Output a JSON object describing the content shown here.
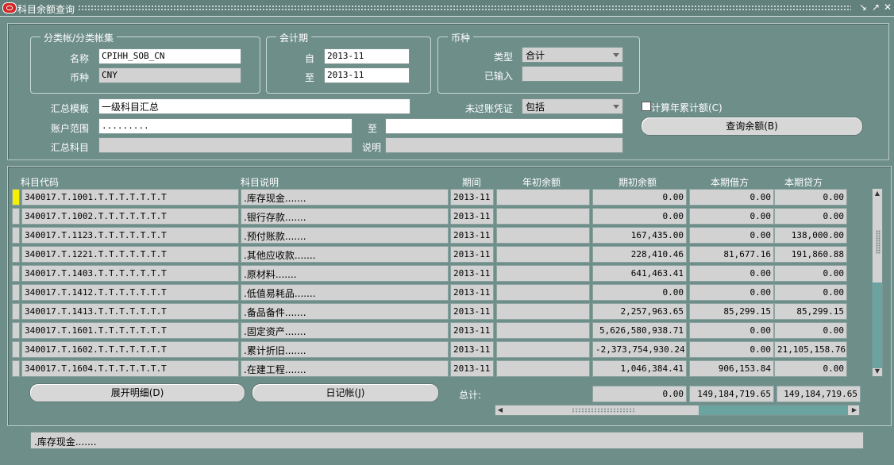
{
  "window": {
    "title": "科目余额查询"
  },
  "ledger_group": {
    "legend": "分类帐/分类帐集",
    "name_label": "名称",
    "name_value": "CPIHH_SOB_CN",
    "currency_label": "币种",
    "currency_value": "CNY"
  },
  "period_group": {
    "legend": "会计期",
    "from_label": "自",
    "from_value": "2013-11",
    "to_label": "至",
    "to_value": "2013-11"
  },
  "currency_group": {
    "legend": "币种",
    "type_label": "类型",
    "type_value": "合计",
    "entered_label": "已输入",
    "entered_value": ""
  },
  "summary": {
    "template_label": "汇总模板",
    "template_value": "一级科目汇总",
    "unposted_label": "未过账凭证",
    "unposted_value": "包括",
    "ytd_label": "计算年累计额(C)",
    "range_label": "账户范围",
    "range_from": ".........",
    "range_to_label": "至",
    "range_to": "",
    "summary_account_label": "汇总科目",
    "summary_account_value": "",
    "desc_label": "说明",
    "desc_value": "",
    "query_button": "查询余额(B)"
  },
  "table": {
    "headers": [
      "科目代码",
      "科目说明",
      "期间",
      "年初余额",
      "期初余额",
      "本期借方",
      "本期贷方"
    ],
    "rows": [
      {
        "code": "340017.T.1001.T.T.T.T.T.T.T",
        "desc": ".库存现金.......",
        "period": "2013-11",
        "year_begin": "",
        "begin": "0.00",
        "debit": "0.00",
        "credit": "0.00"
      },
      {
        "code": "340017.T.1002.T.T.T.T.T.T.T",
        "desc": ".银行存款.......",
        "period": "2013-11",
        "year_begin": "",
        "begin": "0.00",
        "debit": "0.00",
        "credit": "0.00"
      },
      {
        "code": "340017.T.1123.T.T.T.T.T.T.T",
        "desc": ".预付账款.......",
        "period": "2013-11",
        "year_begin": "",
        "begin": "167,435.00",
        "debit": "0.00",
        "credit": "138,000.00"
      },
      {
        "code": "340017.T.1221.T.T.T.T.T.T.T",
        "desc": ".其他应收款.......",
        "period": "2013-11",
        "year_begin": "",
        "begin": "228,410.46",
        "debit": "81,677.16",
        "credit": "191,860.88"
      },
      {
        "code": "340017.T.1403.T.T.T.T.T.T.T",
        "desc": ".原材料.......",
        "period": "2013-11",
        "year_begin": "",
        "begin": "641,463.41",
        "debit": "0.00",
        "credit": "0.00"
      },
      {
        "code": "340017.T.1412.T.T.T.T.T.T.T",
        "desc": ".低值易耗品.......",
        "period": "2013-11",
        "year_begin": "",
        "begin": "0.00",
        "debit": "0.00",
        "credit": "0.00"
      },
      {
        "code": "340017.T.1413.T.T.T.T.T.T.T",
        "desc": ".备品备件.......",
        "period": "2013-11",
        "year_begin": "",
        "begin": "2,257,963.65",
        "debit": "85,299.15",
        "credit": "85,299.15"
      },
      {
        "code": "340017.T.1601.T.T.T.T.T.T.T",
        "desc": ".固定资产.......",
        "period": "2013-11",
        "year_begin": "",
        "begin": "5,626,580,938.71",
        "debit": "0.00",
        "credit": "0.00"
      },
      {
        "code": "340017.T.1602.T.T.T.T.T.T.T",
        "desc": ".累计折旧.......",
        "period": "2013-11",
        "year_begin": "",
        "begin": "-2,373,754,930.24",
        "debit": "0.00",
        "credit": "21,105,158.76"
      },
      {
        "code": "340017.T.1604.T.T.T.T.T.T.T",
        "desc": ".在建工程.......",
        "period": "2013-11",
        "year_begin": "",
        "begin": "1,046,384.41",
        "debit": "906,153.84",
        "credit": "0.00"
      }
    ]
  },
  "footer": {
    "detail_button": "展开明细(D)",
    "journal_button": "日记帐(J)",
    "total_label": "总计:",
    "total_begin": "0.00",
    "total_debit": "149,184,719.65",
    "total_credit": "149,184,719.65",
    "status_text": ".库存现金......."
  }
}
